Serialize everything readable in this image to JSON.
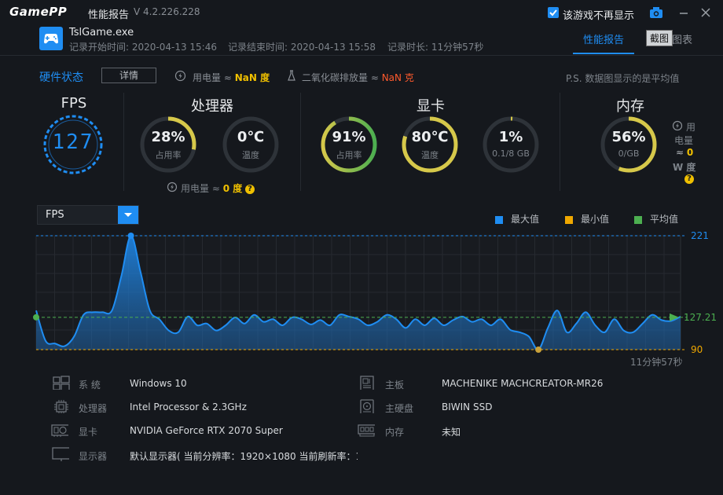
{
  "app": {
    "logo": "GamePP",
    "window_title": "性能报告",
    "version": "V 4.2.226.228",
    "hide_game_label": "该游戏不再显示"
  },
  "game": {
    "name": "TslGame.exe",
    "start_time": "记录开始时间: 2020-04-13 15:46",
    "end_time": "记录结束时间: 2020-04-13 15:58",
    "duration": "记录时长: 11分钟57秒"
  },
  "tabs": {
    "report": "性能报告",
    "chart": "图表",
    "tooltip": "截图"
  },
  "hw_status": {
    "title": "硬件状态",
    "detail_button": "详情",
    "power_label": "用电量 ≈",
    "power_value": "NaN 度",
    "co2_label": "二氧化碳排放量 ≈",
    "co2_value": "NaN 克",
    "note": "P.S. 数据图显示的是平均值"
  },
  "fps": {
    "title": "FPS",
    "value": "127"
  },
  "cpu": {
    "title": "处理器",
    "usage": {
      "value": "28%",
      "label": "占用率",
      "fraction": 0.28
    },
    "temp": {
      "value": "0℃",
      "label": "温度",
      "fraction": 0
    },
    "power_label": "用电量 ≈",
    "power_value": "0 度"
  },
  "gpu": {
    "title": "显卡",
    "usage": {
      "value": "91%",
      "label": "占用率",
      "fraction": 0.91
    },
    "temp": {
      "value": "80℃",
      "label": "温度",
      "fraction": 0.8
    },
    "vram": {
      "value": "1%",
      "label": "0.1/8 GB",
      "fraction": 0.01
    }
  },
  "memory": {
    "title": "内存",
    "usage": {
      "value": "56%",
      "label": "0/GB",
      "fraction": 0.56
    },
    "power_label_1": "用",
    "power_label_2": "电量",
    "power_approx": "≈",
    "power_value": "0",
    "power_unit": "W 度"
  },
  "chart_panel": {
    "select_value": "FPS",
    "legend": [
      {
        "label": "最大值",
        "color": "#1f8df2"
      },
      {
        "label": "最小值",
        "color": "#f0a800"
      },
      {
        "label": "平均值",
        "color": "#4caf50"
      }
    ],
    "max_label": "221",
    "avg_label": "127.21",
    "min_label": "90",
    "duration_label": "11分钟57秒"
  },
  "chart_data": {
    "type": "area",
    "series": [
      {
        "values": [
          135,
          100,
          97,
          94,
          105,
          130,
          133,
          133,
          135,
          175,
          221,
          180,
          135,
          125,
          112,
          110,
          128,
          118,
          120,
          112,
          118,
          127,
          120,
          130,
          122,
          125,
          118,
          127,
          125,
          119,
          124,
          118,
          130,
          128,
          125,
          118,
          122,
          130,
          125,
          115,
          125,
          118,
          126,
          118,
          124,
          128,
          122,
          125,
          118,
          125,
          113,
          110,
          105,
          90,
          115,
          135,
          110,
          120,
          133,
          118,
          110,
          125,
          112,
          110,
          120,
          130,
          124,
          123,
          128
        ]
      }
    ],
    "ylim": [
      90,
      221
    ],
    "max": 221,
    "min": 90,
    "average": 127.21
  },
  "system": {
    "os_label": "系 统",
    "os_value": "Windows 10",
    "cpu_label": "处理器",
    "cpu_value": "Intel Processor & 2.3GHz",
    "gpu_label": "显卡",
    "gpu_value": "NVIDIA GeForce RTX 2070 Super",
    "display_label": "显示器",
    "display_value": "默认显示器( 当前分辨率：1920×1080 当前刷新率：1",
    "board_label": "主板",
    "board_value": "MACHENIKE MACHCREATOR-MR26",
    "disk_label": "主硬盘",
    "disk_value": "BIWIN SSD",
    "ram_label": "内存",
    "ram_value": "未知"
  },
  "colors": {
    "accent": "#1f8df2",
    "yellow": "#f0c000",
    "green": "#4caf50",
    "ring_track": "#2e3339"
  }
}
